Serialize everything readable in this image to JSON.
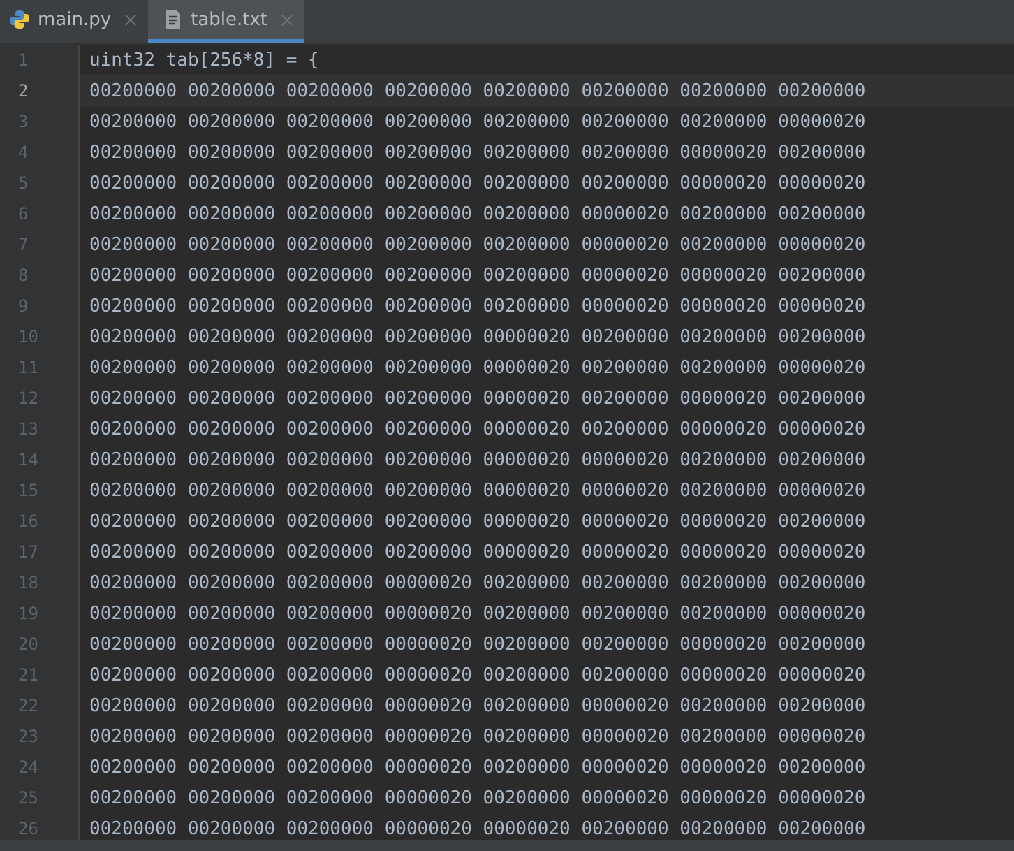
{
  "tabs": [
    {
      "label": "main.py",
      "kind": "python",
      "selected": false
    },
    {
      "label": "table.txt",
      "kind": "text",
      "selected": true
    }
  ],
  "editor": {
    "lines": [
      {
        "number": "1",
        "text": "uint32 tab[256*8] = {",
        "current": false
      },
      {
        "number": "2",
        "text": "00200000 00200000 00200000 00200000 00200000 00200000 00200000 00200000",
        "current": true
      },
      {
        "number": "3",
        "text": "00200000 00200000 00200000 00200000 00200000 00200000 00200000 00000020",
        "current": false
      },
      {
        "number": "4",
        "text": "00200000 00200000 00200000 00200000 00200000 00200000 00000020 00200000",
        "current": false
      },
      {
        "number": "5",
        "text": "00200000 00200000 00200000 00200000 00200000 00200000 00000020 00000020",
        "current": false
      },
      {
        "number": "6",
        "text": "00200000 00200000 00200000 00200000 00200000 00000020 00200000 00200000",
        "current": false
      },
      {
        "number": "7",
        "text": "00200000 00200000 00200000 00200000 00200000 00000020 00200000 00000020",
        "current": false
      },
      {
        "number": "8",
        "text": "00200000 00200000 00200000 00200000 00200000 00000020 00000020 00200000",
        "current": false
      },
      {
        "number": "9",
        "text": "00200000 00200000 00200000 00200000 00200000 00000020 00000020 00000020",
        "current": false
      },
      {
        "number": "10",
        "text": "00200000 00200000 00200000 00200000 00000020 00200000 00200000 00200000",
        "current": false
      },
      {
        "number": "11",
        "text": "00200000 00200000 00200000 00200000 00000020 00200000 00200000 00000020",
        "current": false
      },
      {
        "number": "12",
        "text": "00200000 00200000 00200000 00200000 00000020 00200000 00000020 00200000",
        "current": false
      },
      {
        "number": "13",
        "text": "00200000 00200000 00200000 00200000 00000020 00200000 00000020 00000020",
        "current": false
      },
      {
        "number": "14",
        "text": "00200000 00200000 00200000 00200000 00000020 00000020 00200000 00200000",
        "current": false
      },
      {
        "number": "15",
        "text": "00200000 00200000 00200000 00200000 00000020 00000020 00200000 00000020",
        "current": false
      },
      {
        "number": "16",
        "text": "00200000 00200000 00200000 00200000 00000020 00000020 00000020 00200000",
        "current": false
      },
      {
        "number": "17",
        "text": "00200000 00200000 00200000 00200000 00000020 00000020 00000020 00000020",
        "current": false
      },
      {
        "number": "18",
        "text": "00200000 00200000 00200000 00000020 00200000 00200000 00200000 00200000",
        "current": false
      },
      {
        "number": "19",
        "text": "00200000 00200000 00200000 00000020 00200000 00200000 00200000 00000020",
        "current": false
      },
      {
        "number": "20",
        "text": "00200000 00200000 00200000 00000020 00200000 00200000 00000020 00200000",
        "current": false
      },
      {
        "number": "21",
        "text": "00200000 00200000 00200000 00000020 00200000 00200000 00000020 00000020",
        "current": false
      },
      {
        "number": "22",
        "text": "00200000 00200000 00200000 00000020 00200000 00000020 00200000 00200000",
        "current": false
      },
      {
        "number": "23",
        "text": "00200000 00200000 00200000 00000020 00200000 00000020 00200000 00000020",
        "current": false
      },
      {
        "number": "24",
        "text": "00200000 00200000 00200000 00000020 00200000 00000020 00000020 00200000",
        "current": false
      },
      {
        "number": "25",
        "text": "00200000 00200000 00200000 00000020 00200000 00000020 00000020 00000020",
        "current": false
      },
      {
        "number": "26",
        "text": "00200000 00200000 00200000 00000020 00000020 00200000 00200000 00200000",
        "current": false
      }
    ]
  }
}
